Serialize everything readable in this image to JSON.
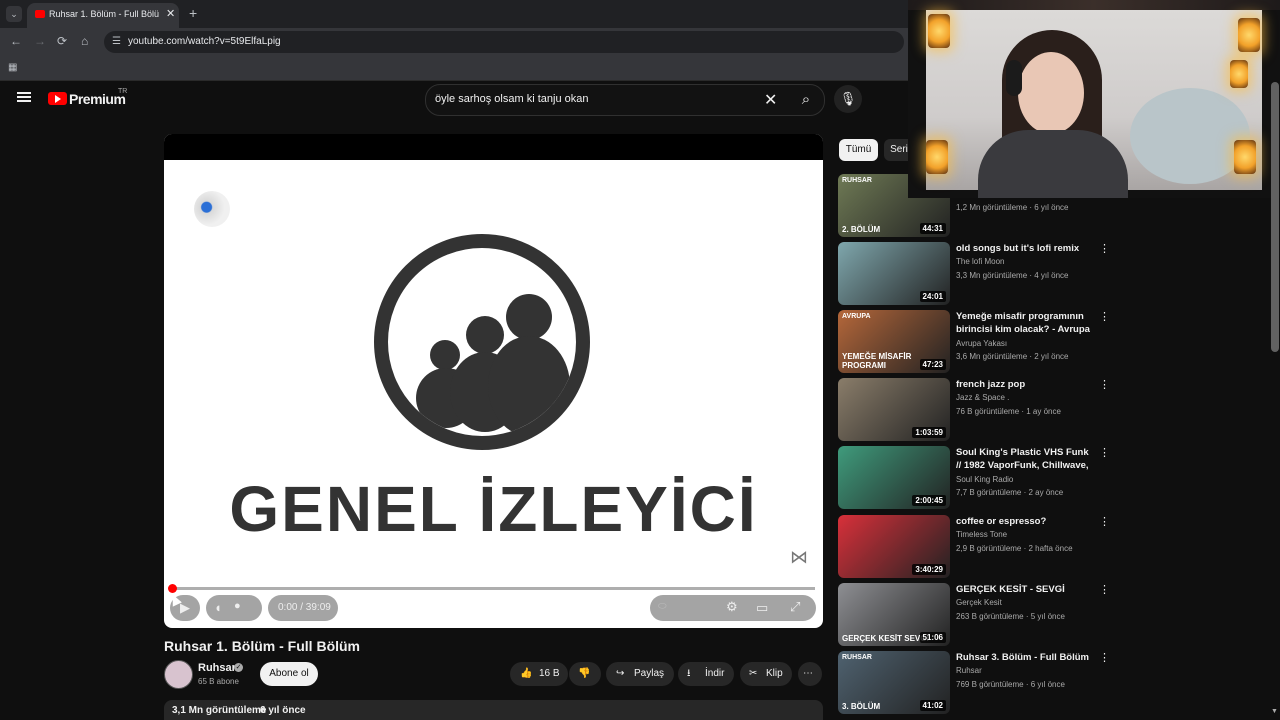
{
  "browser": {
    "tab_title": "Ruhsar 1. Bölüm - Full Bölüm",
    "tab_close": "✕",
    "new_tab": "+",
    "url": "youtube.com/watch?v=5t9ElfaLpig"
  },
  "header": {
    "brand": "Premium",
    "country": "TR",
    "search_value": "öyle sarhoş olsam ki tanju okan"
  },
  "player": {
    "rating_text": "GENEL İZLEYİCİ",
    "time": "0:00 / 39:09",
    "progress": 0.0
  },
  "video": {
    "title": "Ruhsar 1. Bölüm - Full Bölüm",
    "channel": "Ruhsar",
    "subscribers": "65 B abone",
    "subscribe_label": "Abone ol",
    "likes": "16 B",
    "share_label": "Paylaş",
    "download_label": "İndir",
    "clip_label": "Klip",
    "views": "3,1 Mn görüntüleme",
    "age": "6 yıl önce"
  },
  "chips": [
    "Tümü",
    "Seri"
  ],
  "recommendations": [
    {
      "title": "",
      "channel": "",
      "meta": "1,2 Mn görüntüleme · 6 yıl önce",
      "duration": "44:31",
      "thumb_top": "RUHSAR",
      "thumb_label": "2. BÖLÜM",
      "color": "#6f7a55"
    },
    {
      "title": "old songs but it's lofi remix",
      "channel": "The lofi Moon",
      "meta": "3,3 Mn görüntüleme · 4 yıl önce",
      "duration": "24:01",
      "thumb_top": "",
      "thumb_label": "",
      "color": "#7fa7ad"
    },
    {
      "title": "Yemeğe misafir programının birincisi kim olacak? - Avrupa ...",
      "channel": "Avrupa Yakası",
      "meta": "3,6 Mn görüntüleme · 2 yıl önce",
      "duration": "47:23",
      "thumb_top": "AVRUPA",
      "thumb_label": "YEMEĞE MİSAFİR PROGRAMI",
      "color": "#b5673a"
    },
    {
      "title": "french jazz pop",
      "channel": "Jazz & Space .",
      "meta": "76 B görüntüleme · 1 ay önce",
      "duration": "1:03:59",
      "thumb_top": "",
      "thumb_label": "",
      "color": "#8a7d6a"
    },
    {
      "title": "Soul King's Plastic VHS Funk // 1982 VaporFunk, Chillwave, ...",
      "channel": "Soul King Radio",
      "meta": "7,7 B görüntüleme · 2 ay önce",
      "duration": "2:00:45",
      "thumb_top": "",
      "thumb_label": "",
      "color": "#3f9b7c"
    },
    {
      "title": "coffee or espresso?",
      "channel": "Timeless Tone",
      "meta": "2,9 B görüntüleme · 2 hafta önce",
      "duration": "3:40:29",
      "thumb_top": "",
      "thumb_label": "",
      "color": "#d8303a"
    },
    {
      "title": "GERÇEK KESİT - SEVGİ",
      "channel": "Gerçek Kesit",
      "meta": "263 B görüntüleme · 5 yıl önce",
      "duration": "51:06",
      "thumb_top": "",
      "thumb_label": "GERÇEK KESİT SEVGİ",
      "color": "#8e8f93"
    },
    {
      "title": "Ruhsar 3. Bölüm - Full Bölüm",
      "channel": "Ruhsar",
      "meta": "769 B görüntüleme · 6 yıl önce",
      "duration": "41:02",
      "thumb_top": "RUHSAR",
      "thumb_label": "3. BÖLÜM",
      "color": "#4f6270"
    }
  ],
  "colors": {
    "accent": "#ff0000",
    "background": "#0f0f0f",
    "chip_active": "#f1f1f1"
  }
}
